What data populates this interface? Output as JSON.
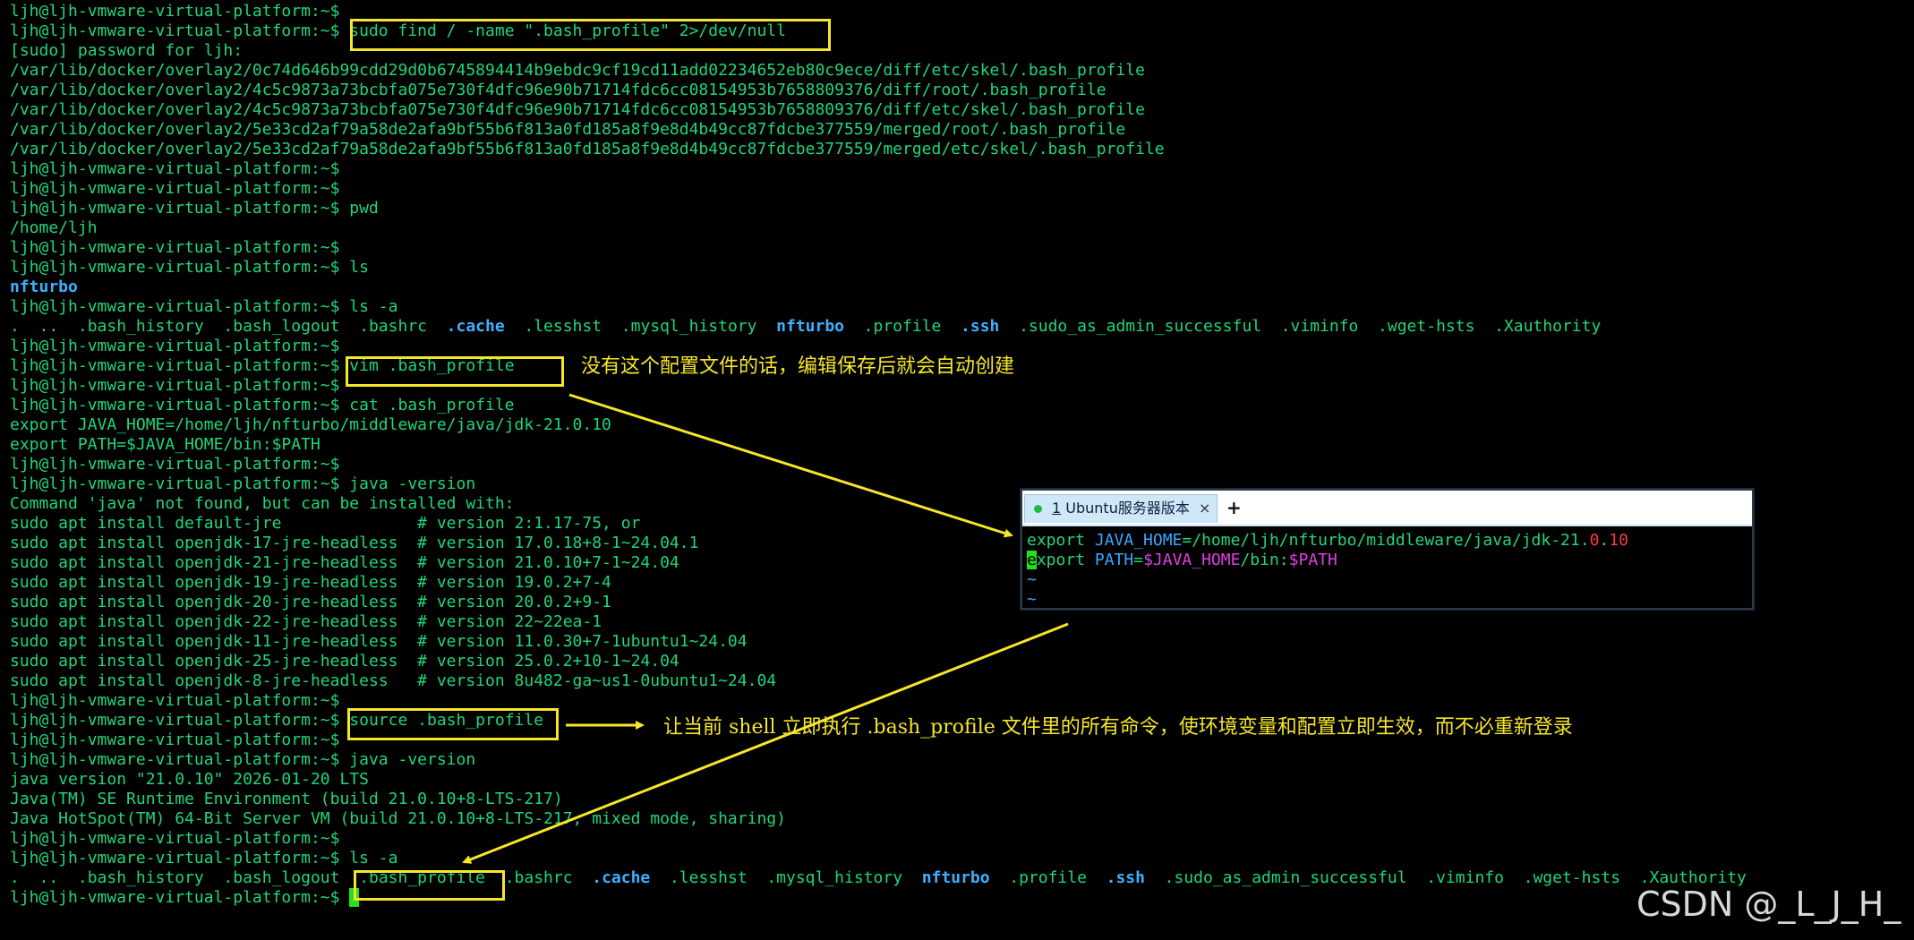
{
  "terminal": {
    "lines": [
      [
        {
          "t": "ljh@ljh-vmware-virtual-platform:~$",
          "c": "green"
        }
      ],
      [
        {
          "t": "ljh@ljh-vmware-virtual-platform:~$ ",
          "c": "green"
        },
        {
          "t": "sudo find / -name \".bash_profile\" 2>/dev/null",
          "c": "green"
        }
      ],
      [
        {
          "t": "[sudo] password for ljh:",
          "c": "green"
        }
      ],
      [
        {
          "t": "/var/lib/docker/overlay2/0c74d646b99cdd29d0b6745894414b9ebdc9cf19cd11add02234652eb80c9ece/diff/etc/skel/.bash_profile",
          "c": "green"
        }
      ],
      [
        {
          "t": "/var/lib/docker/overlay2/4c5c9873a73bcbfa075e730f4dfc96e90b71714fdc6cc08154953b7658809376/diff/root/.bash_profile",
          "c": "green"
        }
      ],
      [
        {
          "t": "/var/lib/docker/overlay2/4c5c9873a73bcbfa075e730f4dfc96e90b71714fdc6cc08154953b7658809376/diff/etc/skel/.bash_profile",
          "c": "green"
        }
      ],
      [
        {
          "t": "/var/lib/docker/overlay2/5e33cd2af79a58de2afa9bf55b6f813a0fd185a8f9e8d4b49cc87fdcbe377559/merged/root/.bash_profile",
          "c": "green"
        }
      ],
      [
        {
          "t": "/var/lib/docker/overlay2/5e33cd2af79a58de2afa9bf55b6f813a0fd185a8f9e8d4b49cc87fdcbe377559/merged/etc/skel/.bash_profile",
          "c": "green"
        }
      ],
      [
        {
          "t": "ljh@ljh-vmware-virtual-platform:~$",
          "c": "green"
        }
      ],
      [
        {
          "t": "ljh@ljh-vmware-virtual-platform:~$",
          "c": "green"
        }
      ],
      [
        {
          "t": "ljh@ljh-vmware-virtual-platform:~$ pwd",
          "c": "green"
        }
      ],
      [
        {
          "t": "/home/ljh",
          "c": "green"
        }
      ],
      [
        {
          "t": "ljh@ljh-vmware-virtual-platform:~$",
          "c": "green"
        }
      ],
      [
        {
          "t": "ljh@ljh-vmware-virtual-platform:~$ ls",
          "c": "green"
        }
      ],
      [
        {
          "t": "nfturbo",
          "c": "cyan-b"
        }
      ],
      [
        {
          "t": "ljh@ljh-vmware-virtual-platform:~$ ls -a",
          "c": "green"
        }
      ],
      [
        {
          "t": ".  ..  .bash_history  .bash_logout  .bashrc  ",
          "c": "green"
        },
        {
          "t": ".cache",
          "c": "cyan-b"
        },
        {
          "t": "  .lesshst  .mysql_history  ",
          "c": "green"
        },
        {
          "t": "nfturbo",
          "c": "cyan-b"
        },
        {
          "t": "  .profile  ",
          "c": "green"
        },
        {
          "t": ".ssh",
          "c": "cyan-b"
        },
        {
          "t": "  .sudo_as_admin_successful  .viminfo  .wget-hsts  .Xauthority",
          "c": "green"
        }
      ],
      [
        {
          "t": "ljh@ljh-vmware-virtual-platform:~$",
          "c": "green"
        }
      ],
      [
        {
          "t": "ljh@ljh-vmware-virtual-platform:~$ ",
          "c": "green"
        },
        {
          "t": "vim .bash_profile",
          "c": "green"
        }
      ],
      [
        {
          "t": "ljh@ljh-vmware-virtual-platform:~$",
          "c": "green"
        }
      ],
      [
        {
          "t": "ljh@ljh-vmware-virtual-platform:~$ cat .bash_profile",
          "c": "green"
        }
      ],
      [
        {
          "t": "export JAVA_HOME=/home/ljh/nfturbo/middleware/java/jdk-21.0.10",
          "c": "green"
        }
      ],
      [
        {
          "t": "export PATH=$JAVA_HOME/bin:$PATH",
          "c": "green"
        }
      ],
      [
        {
          "t": "ljh@ljh-vmware-virtual-platform:~$",
          "c": "green"
        }
      ],
      [
        {
          "t": "ljh@ljh-vmware-virtual-platform:~$ java -version",
          "c": "green"
        }
      ],
      [
        {
          "t": "Command 'java' not found, but can be installed with:",
          "c": "green"
        }
      ],
      [
        {
          "t": "sudo apt install default-jre              # version 2:1.17-75, or",
          "c": "green"
        }
      ],
      [
        {
          "t": "sudo apt install openjdk-17-jre-headless  # version 17.0.18+8-1~24.04.1",
          "c": "green"
        }
      ],
      [
        {
          "t": "sudo apt install openjdk-21-jre-headless  # version 21.0.10+7-1~24.04",
          "c": "green"
        }
      ],
      [
        {
          "t": "sudo apt install openjdk-19-jre-headless  # version 19.0.2+7-4",
          "c": "green"
        }
      ],
      [
        {
          "t": "sudo apt install openjdk-20-jre-headless  # version 20.0.2+9-1",
          "c": "green"
        }
      ],
      [
        {
          "t": "sudo apt install openjdk-22-jre-headless  # version 22~22ea-1",
          "c": "green"
        }
      ],
      [
        {
          "t": "sudo apt install openjdk-11-jre-headless  # version 11.0.30+7-1ubuntu1~24.04",
          "c": "green"
        }
      ],
      [
        {
          "t": "sudo apt install openjdk-25-jre-headless  # version 25.0.2+10-1~24.04",
          "c": "green"
        }
      ],
      [
        {
          "t": "sudo apt install openjdk-8-jre-headless   # version 8u482-ga~us1-0ubuntu1~24.04",
          "c": "green"
        }
      ],
      [
        {
          "t": "ljh@ljh-vmware-virtual-platform:~$",
          "c": "green"
        }
      ],
      [
        {
          "t": "ljh@ljh-vmware-virtual-platform:~$ ",
          "c": "green"
        },
        {
          "t": "source .bash_profile",
          "c": "green"
        }
      ],
      [
        {
          "t": "ljh@ljh-vmware-virtual-platform:~$",
          "c": "green"
        }
      ],
      [
        {
          "t": "ljh@ljh-vmware-virtual-platform:~$ java -version",
          "c": "green"
        }
      ],
      [
        {
          "t": "java version \"21.0.10\" 2026-01-20 LTS",
          "c": "green"
        }
      ],
      [
        {
          "t": "Java(TM) SE Runtime Environment (build 21.0.10+8-LTS-217)",
          "c": "green"
        }
      ],
      [
        {
          "t": "Java HotSpot(TM) 64-Bit Server VM (build 21.0.10+8-LTS-217, mixed mode, sharing)",
          "c": "green"
        }
      ],
      [
        {
          "t": "ljh@ljh-vmware-virtual-platform:~$",
          "c": "green"
        }
      ],
      [
        {
          "t": "ljh@ljh-vmware-virtual-platform:~$ ls -a",
          "c": "green"
        }
      ],
      [
        {
          "t": ".  ..  .bash_history  .bash_logout  ",
          "c": "green"
        },
        {
          "t": ".bash_profile",
          "c": "green"
        },
        {
          "t": "  .bashrc  ",
          "c": "green"
        },
        {
          "t": ".cache",
          "c": "cyan-b"
        },
        {
          "t": "  .lesshst  .mysql_history  ",
          "c": "green"
        },
        {
          "t": "nfturbo",
          "c": "cyan-b"
        },
        {
          "t": "  .profile  ",
          "c": "green"
        },
        {
          "t": ".ssh",
          "c": "cyan-b"
        },
        {
          "t": "  .sudo_as_admin_successful  .viminfo  .wget-hsts  .Xauthority",
          "c": "green"
        }
      ],
      [
        {
          "t": "ljh@ljh-vmware-virtual-platform:~$ ",
          "c": "green"
        },
        {
          "t": " ",
          "c": "cursor"
        }
      ]
    ]
  },
  "annotations": {
    "vim_note": "没有这个配置文件的话，编辑保存后就会自动创建",
    "source_note": "让当前 shell 立即执行 .bash_profile 文件里的所有命令，使环境变量和配置立即生效，而不必重新登录"
  },
  "vim_popup": {
    "tab_number": "1",
    "tab_title": " Ubuntu服务器版本",
    "close_glyph": "×",
    "add_glyph": "+",
    "line1": [
      {
        "t": "export ",
        "c": "green"
      },
      {
        "t": "JAVA_HOME",
        "c": "cyan"
      },
      {
        "t": "=/home/ljh/nfturbo/middleware/java/jdk-21.",
        "c": "green"
      },
      {
        "t": "0",
        "c": "red"
      },
      {
        "t": ".",
        "c": "green"
      },
      {
        "t": "10",
        "c": "red"
      }
    ],
    "line2": [
      {
        "t": "e",
        "c": "cursor"
      },
      {
        "t": "xport ",
        "c": "green"
      },
      {
        "t": "PATH",
        "c": "cyan"
      },
      {
        "t": "=",
        "c": "green"
      },
      {
        "t": "$JAVA_HOME",
        "c": "mag"
      },
      {
        "t": "/bin:",
        "c": "green"
      },
      {
        "t": "$PATH",
        "c": "mag"
      }
    ],
    "tilde1": "~",
    "tilde2": "~"
  },
  "colors": {
    "highlight": "#f6e62a",
    "terminal_green": "#20d67a",
    "dir_blue": "#3fb0ff"
  },
  "watermark": "CSDN @_L_J_H_"
}
